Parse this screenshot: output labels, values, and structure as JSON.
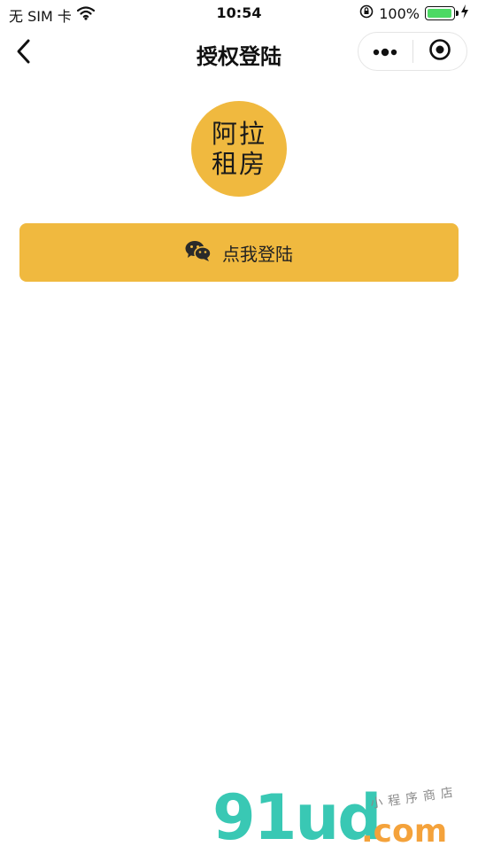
{
  "status_bar": {
    "carrier": "无 SIM 卡",
    "time": "10:54",
    "battery_percent": "100%",
    "battery_level": 1.0
  },
  "nav": {
    "title": "授权登陆",
    "icons": {
      "back": "chevron-left-icon",
      "more": "more-dots-icon",
      "close": "target-circle-icon"
    }
  },
  "logo": {
    "line1": "阿拉",
    "line2": "租房"
  },
  "login_button": {
    "label": "点我登陆",
    "icon": "wechat-icon"
  },
  "watermark": {
    "brand": "91ud",
    "tld": ".com",
    "tagline": "小程序商店"
  },
  "colors": {
    "accent": "#f0b93f",
    "watermark_brand": "#39c8b4",
    "watermark_tld": "#f4a23b",
    "battery": "#4cd964"
  }
}
